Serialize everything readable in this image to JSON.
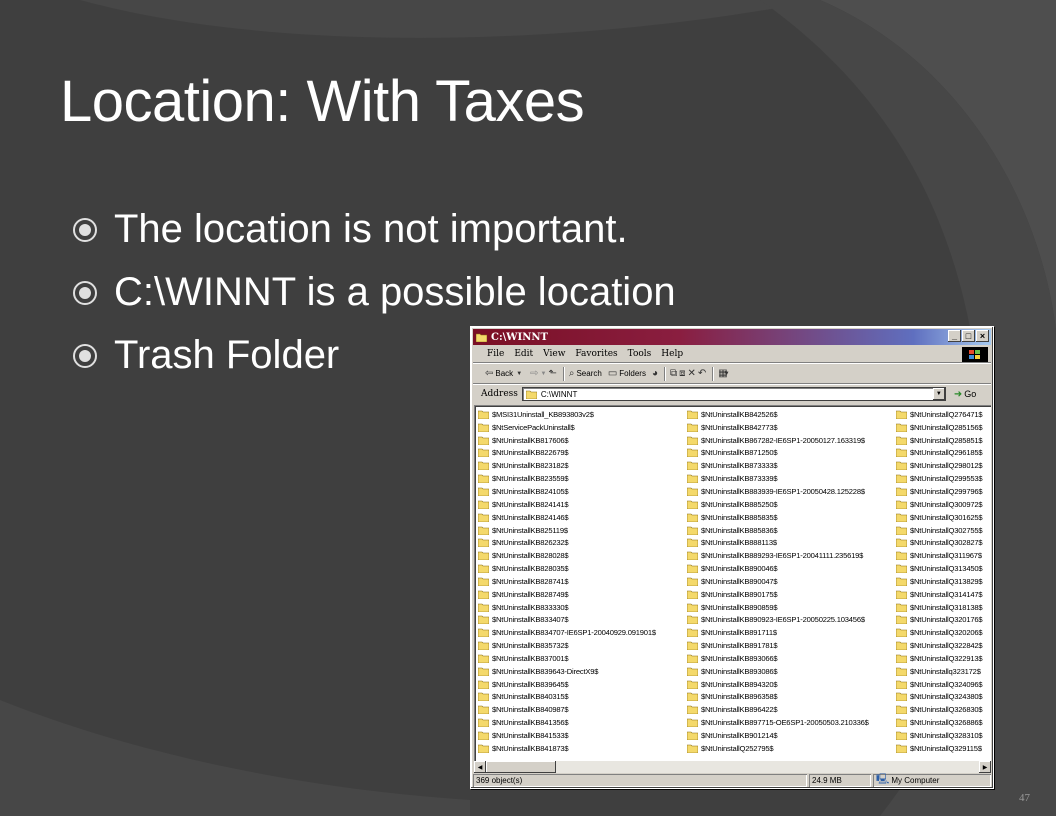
{
  "slide": {
    "title": "Location: With Taxes",
    "bullets": [
      "The location is not important.",
      "C:\\WINNT is a possible location",
      "Trash Folder"
    ],
    "page_number": "47"
  },
  "explorer": {
    "title": "C:\\WINNT",
    "window_buttons": [
      "_",
      "□",
      "×"
    ],
    "menu": [
      "File",
      "Edit",
      "View",
      "Favorites",
      "Tools",
      "Help"
    ],
    "toolbar": {
      "back": "Back",
      "search": "Search",
      "folders": "Folders"
    },
    "address": {
      "label": "Address",
      "value": "C:\\WINNT",
      "go": "Go"
    },
    "files": {
      "col1": [
        "$MSI31Uninstall_KB893803v2$",
        "$NtServicePackUninstall$",
        "$NtUninstallKB817606$",
        "$NtUninstallKB822679$",
        "$NtUninstallKB823182$",
        "$NtUninstallKB823559$",
        "$NtUninstallKB824105$",
        "$NtUninstallKB824141$",
        "$NtUninstallKB824146$",
        "$NtUninstallKB825119$",
        "$NtUninstallKB826232$",
        "$NtUninstallKB828028$",
        "$NtUninstallKB828035$",
        "$NtUninstallKB828741$",
        "$NtUninstallKB828749$",
        "$NtUninstallKB833330$",
        "$NtUninstallKB833407$",
        "$NtUninstallKB834707-IE6SP1-20040929.091901$",
        "$NtUninstallKB835732$",
        "$NtUninstallKB837001$",
        "$NtUninstallKB839643-DirectX9$",
        "$NtUninstallKB839645$",
        "$NtUninstallKB840315$",
        "$NtUninstallKB840987$",
        "$NtUninstallKB841356$",
        "$NtUninstallKB841533$",
        "$NtUninstallKB841873$"
      ],
      "col2": [
        "$NtUninstallKB842526$",
        "$NtUninstallKB842773$",
        "$NtUninstallKB867282-IE6SP1-20050127.163319$",
        "$NtUninstallKB871250$",
        "$NtUninstallKB873333$",
        "$NtUninstallKB873339$",
        "$NtUninstallKB883939-IE6SP1-20050428.125228$",
        "$NtUninstallKB885250$",
        "$NtUninstallKB885835$",
        "$NtUninstallKB885836$",
        "$NtUninstallKB888113$",
        "$NtUninstallKB889293-IE6SP1-20041111.235619$",
        "$NtUninstallKB890046$",
        "$NtUninstallKB890047$",
        "$NtUninstallKB890175$",
        "$NtUninstallKB890859$",
        "$NtUninstallKB890923-IE6SP1-20050225.103456$",
        "$NtUninstallKB891711$",
        "$NtUninstallKB891781$",
        "$NtUninstallKB893066$",
        "$NtUninstallKB893086$",
        "$NtUninstallKB894320$",
        "$NtUninstallKB896358$",
        "$NtUninstallKB896422$",
        "$NtUninstallKB897715-OE6SP1-20050503.210336$",
        "$NtUninstallKB901214$",
        "$NtUninstallQ252795$"
      ],
      "col3": [
        "$NtUninstallQ276471$",
        "$NtUninstallQ285156$",
        "$NtUninstallQ285851$",
        "$NtUninstallQ296185$",
        "$NtUninstallQ298012$",
        "$NtUninstallQ299553$",
        "$NtUninstallQ299796$",
        "$NtUninstallQ300972$",
        "$NtUninstallQ301625$",
        "$NtUninstallQ302755$",
        "$NtUninstallQ302827$",
        "$NtUninstallQ311967$",
        "$NtUninstallQ313450$",
        "$NtUninstallQ313829$",
        "$NtUninstallQ314147$",
        "$NtUninstallQ318138$",
        "$NtUninstallQ320176$",
        "$NtUninstallQ320206$",
        "$NtUninstallQ322842$",
        "$NtUninstallQ322913$",
        "$NtUninstallq323172$",
        "$NtUninstallQ324096$",
        "$NtUninstallQ324380$",
        "$NtUninstallQ326830$",
        "$NtUninstallQ326886$",
        "$NtUninstallQ328310$",
        "$NtUninstallQ329115$"
      ]
    },
    "status": {
      "objects": "369 object(s)",
      "size": "24.9 MB",
      "location": "My Computer"
    }
  },
  "colors": {
    "background": "#3f3f3f",
    "swirl": "#4d4d4d",
    "title_text": "#ffffff",
    "titlebar_start": "#7a0f24",
    "titlebar_end": "#a6caf0",
    "folder": "#f4d96b"
  }
}
